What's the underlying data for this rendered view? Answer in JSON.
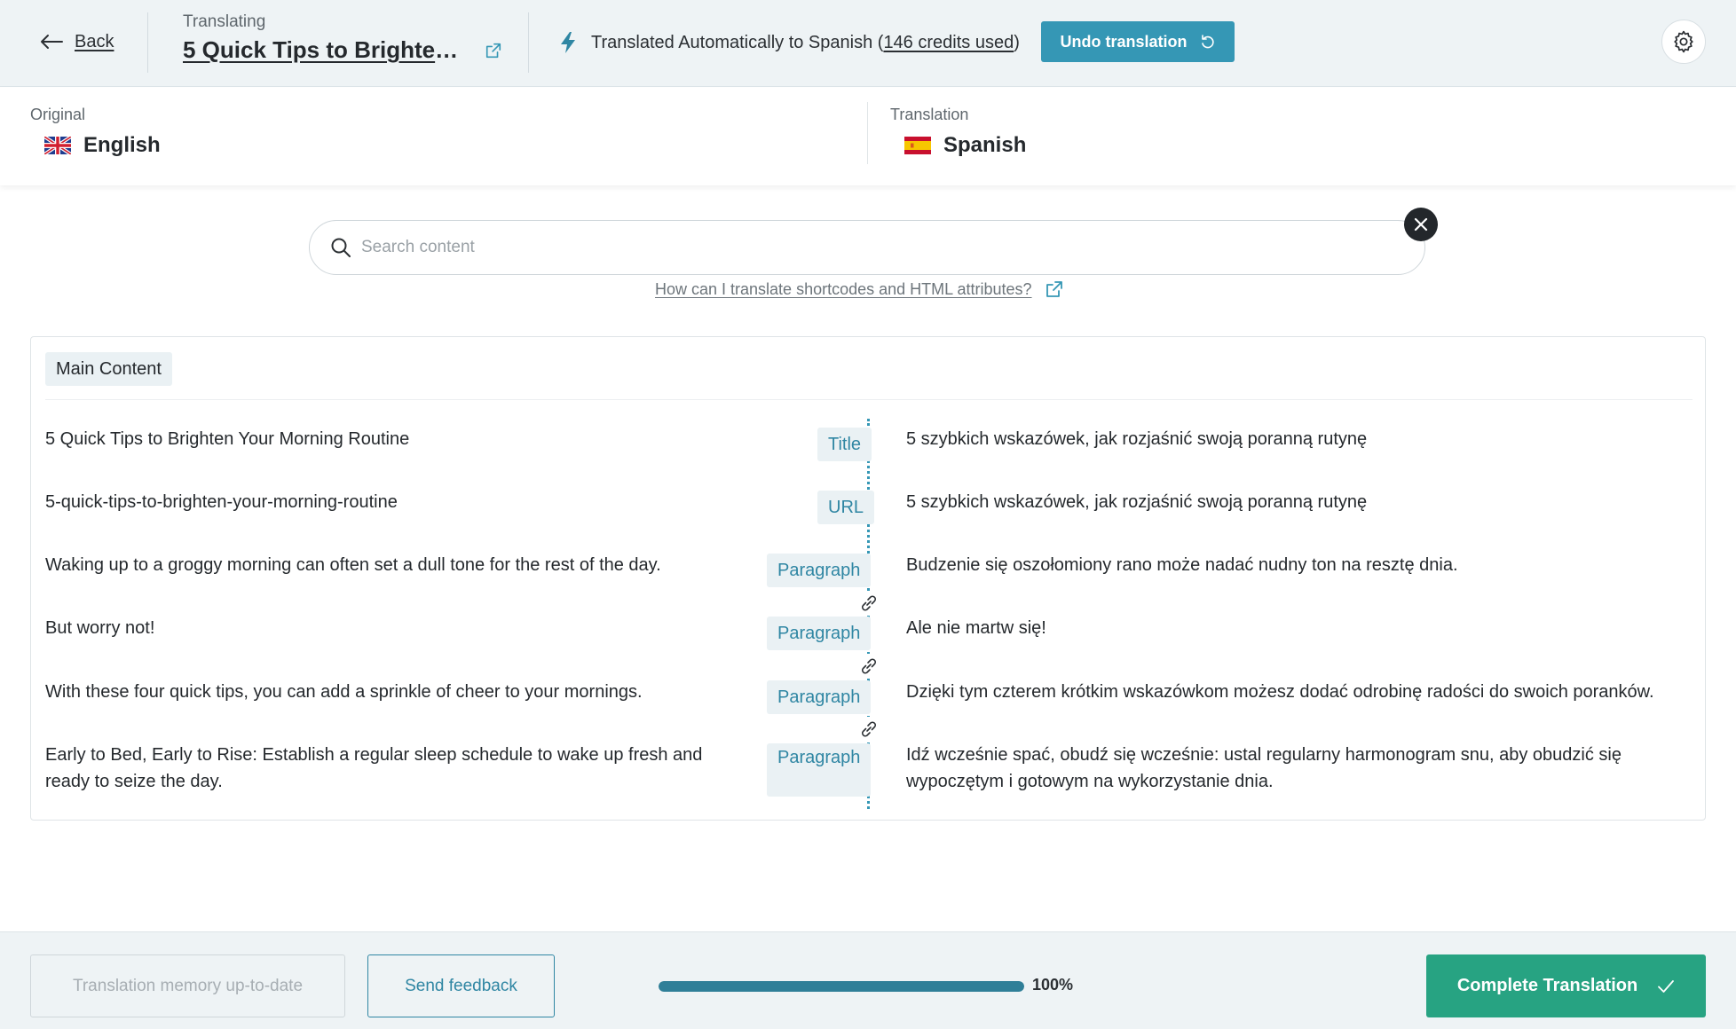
{
  "header": {
    "back_label": "Back",
    "kicker": "Translating",
    "post_title": "5 Quick Tips to Brighten Your Morning Routine",
    "status_prefix": "Translated Automatically to Spanish (",
    "credits": "146 credits used",
    "status_suffix": ")",
    "undo_label": "Undo translation"
  },
  "languages": {
    "original_caption": "Original",
    "original_name": "English",
    "translation_caption": "Translation",
    "translation_name": "Spanish"
  },
  "search": {
    "placeholder": "Search content",
    "help_link": "How can I translate shortcodes and HTML attributes?"
  },
  "content": {
    "section_label": "Main Content",
    "rows": [
      {
        "source": "5 Quick Tips to Brighten Your Morning Routine",
        "type": "Title",
        "translation": "5 szybkich wskazówek, jak rozjaśnić swoją poranną rutynę"
      },
      {
        "source": "5-quick-tips-to-brighten-your-morning-routine",
        "type": "URL",
        "translation": "5 szybkich wskazówek, jak rozjaśnić swoją poranną rutynę"
      },
      {
        "source": "Waking up to a groggy morning can often set a dull tone for the rest of the day.",
        "type": "Paragraph",
        "translation": "Budzenie się oszołomiony rano może nadać nudny ton na resztę dnia."
      },
      {
        "source": "But worry not!",
        "type": "Paragraph",
        "translation": "Ale nie martw się!"
      },
      {
        "source": "With these four quick tips, you can add a sprinkle of cheer to your mornings.",
        "type": "Paragraph",
        "translation": "Dzięki tym czterem krótkim wskazówkom możesz dodać odrobinę radości do swoich poranków."
      },
      {
        "source": "Early to Bed, Early to Rise: Establish a regular sleep schedule to wake up fresh and ready to seize the day.",
        "type": "Paragraph",
        "translation": "Idź wcześnie spać, obudź się wcześnie: ustal regularny harmonogram snu, aby obudzić się wypoczętym i gotowym na wykorzystanie dnia."
      }
    ]
  },
  "footer": {
    "memory_label": "Translation memory up-to-date",
    "feedback_label": "Send feedback",
    "progress_fraction": 1.0,
    "progress_text": "100%",
    "complete_label": "Complete Translation"
  },
  "colors": {
    "accent": "#3597b5",
    "complete": "#27a382",
    "topbar_bg": "#eef3f5"
  },
  "icons": {
    "back": "arrow-left-icon",
    "external": "external-link-icon",
    "auto": "lightning-bolt-icon",
    "undo": "undo-icon",
    "settings": "gear-icon",
    "search": "search-icon",
    "clear": "close-icon",
    "link": "chain-link-icon",
    "complete": "checkmark-icon"
  }
}
